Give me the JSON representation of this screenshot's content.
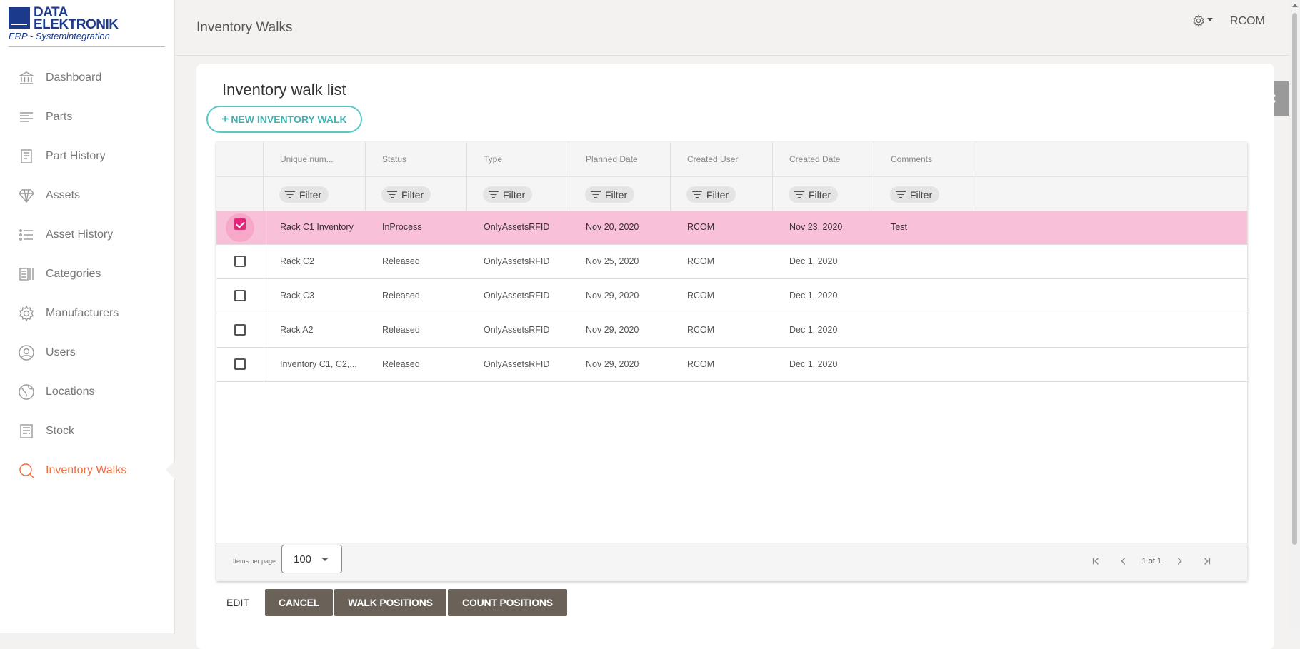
{
  "logo": {
    "line1": "DATA",
    "line2": "ELEKTRONIK",
    "subtitle": "ERP - Systemintegration"
  },
  "sidebar": {
    "items": [
      {
        "label": "Dashboard",
        "icon": "bank-icon",
        "active": false
      },
      {
        "label": "Parts",
        "icon": "lines-icon",
        "active": false
      },
      {
        "label": "Part History",
        "icon": "document-icon",
        "active": false
      },
      {
        "label": "Assets",
        "icon": "diamond-icon",
        "active": false
      },
      {
        "label": "Asset History",
        "icon": "list-icon",
        "active": false
      },
      {
        "label": "Categories",
        "icon": "categories-icon",
        "active": false
      },
      {
        "label": "Manufacturers",
        "icon": "gear-icon",
        "active": false
      },
      {
        "label": "Users",
        "icon": "user-circle-icon",
        "active": false
      },
      {
        "label": "Locations",
        "icon": "globe-icon",
        "active": false
      },
      {
        "label": "Stock",
        "icon": "stock-icon",
        "active": false
      },
      {
        "label": "Inventory Walks",
        "icon": "magnifier-icon",
        "active": true
      }
    ]
  },
  "header": {
    "title": "Inventory Walks",
    "user": "RCOM"
  },
  "main": {
    "card_title": "Inventory walk list",
    "new_button_label": "NEW INVENTORY WALK",
    "new_button_icon": "+",
    "columns": [
      "Unique num...",
      "Status",
      "Type",
      "Planned Date",
      "Created User",
      "Created Date",
      "Comments"
    ],
    "filter_label": "Filter",
    "rows": [
      {
        "selected": true,
        "cells": [
          "Rack C1 Inventory",
          "InProcess",
          "OnlyAssetsRFID",
          "Nov 20, 2020",
          "RCOM",
          "Nov 23, 2020",
          "Test"
        ]
      },
      {
        "selected": false,
        "cells": [
          "Rack C2",
          "Released",
          "OnlyAssetsRFID",
          "Nov 25, 2020",
          "RCOM",
          "Dec 1, 2020",
          ""
        ]
      },
      {
        "selected": false,
        "cells": [
          "Rack C3",
          "Released",
          "OnlyAssetsRFID",
          "Nov 29, 2020",
          "RCOM",
          "Dec 1, 2020",
          ""
        ]
      },
      {
        "selected": false,
        "cells": [
          "Rack A2",
          "Released",
          "OnlyAssetsRFID",
          "Nov 29, 2020",
          "RCOM",
          "Dec 1, 2020",
          ""
        ]
      },
      {
        "selected": false,
        "cells": [
          "Inventory C1, C2,...",
          "Released",
          "OnlyAssetsRFID",
          "Nov 29, 2020",
          "RCOM",
          "Dec 1, 2020",
          ""
        ]
      }
    ],
    "footer": {
      "items_per_page_label": "Items per page",
      "items_per_page": "100",
      "page_info": "1 of 1"
    },
    "actions": {
      "edit": "EDIT",
      "cancel": "CANCEL",
      "walk_positions": "WALK POSITIONS",
      "count_positions": "COUNT POSITIONS"
    }
  },
  "colors": {
    "accent": "#ef6c3e",
    "teal": "#3fb3b2",
    "selected_row": "#f9c0da",
    "checkbox": "#e5257b",
    "action_button": "#6a6259",
    "brand_blue": "#1c3a8c"
  }
}
